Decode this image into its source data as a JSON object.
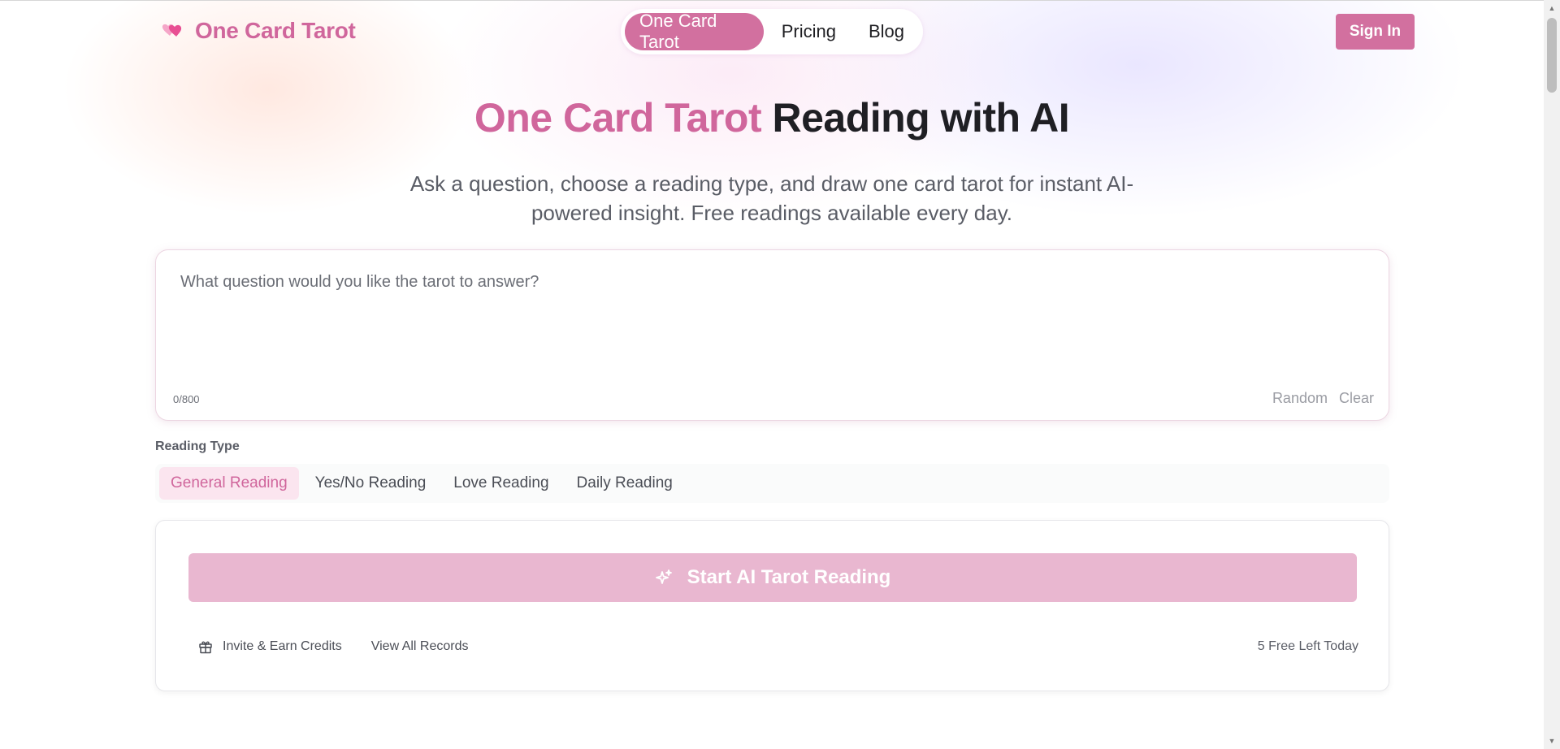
{
  "header": {
    "logo_text": "One Card Tarot",
    "logo_icon": "hearts-icon",
    "nav": [
      {
        "label": "One Card Tarot",
        "active": true
      },
      {
        "label": "Pricing",
        "active": false
      },
      {
        "label": "Blog",
        "active": false
      }
    ],
    "signin_label": "Sign In"
  },
  "hero": {
    "title_accent": "One Card Tarot",
    "title_rest": " Reading with AI",
    "subtitle": "Ask a question, choose a reading type, and draw one card tarot for instant AI-powered insight. Free readings available every day."
  },
  "question": {
    "placeholder": "What question would you like the tarot to answer?",
    "value": "",
    "counter": "0/800",
    "random_label": "Random",
    "clear_label": "Clear"
  },
  "reading_type": {
    "label": "Reading Type",
    "tabs": [
      {
        "label": "General Reading",
        "active": true
      },
      {
        "label": "Yes/No Reading",
        "active": false
      },
      {
        "label": "Love Reading",
        "active": false
      },
      {
        "label": "Daily Reading",
        "active": false
      }
    ]
  },
  "action": {
    "start_label": "Start AI Tarot Reading",
    "start_icon": "sparkle-icon",
    "invite_label": "Invite & Earn Credits",
    "invite_icon": "gift-icon",
    "records_label": "View All Records",
    "free_left": "5 Free Left Today"
  },
  "colors": {
    "brand": "#d0669c",
    "brand_button": "#d2709f",
    "start_button": "#e9b7d0",
    "active_tab_bg": "#fbe5ef"
  }
}
